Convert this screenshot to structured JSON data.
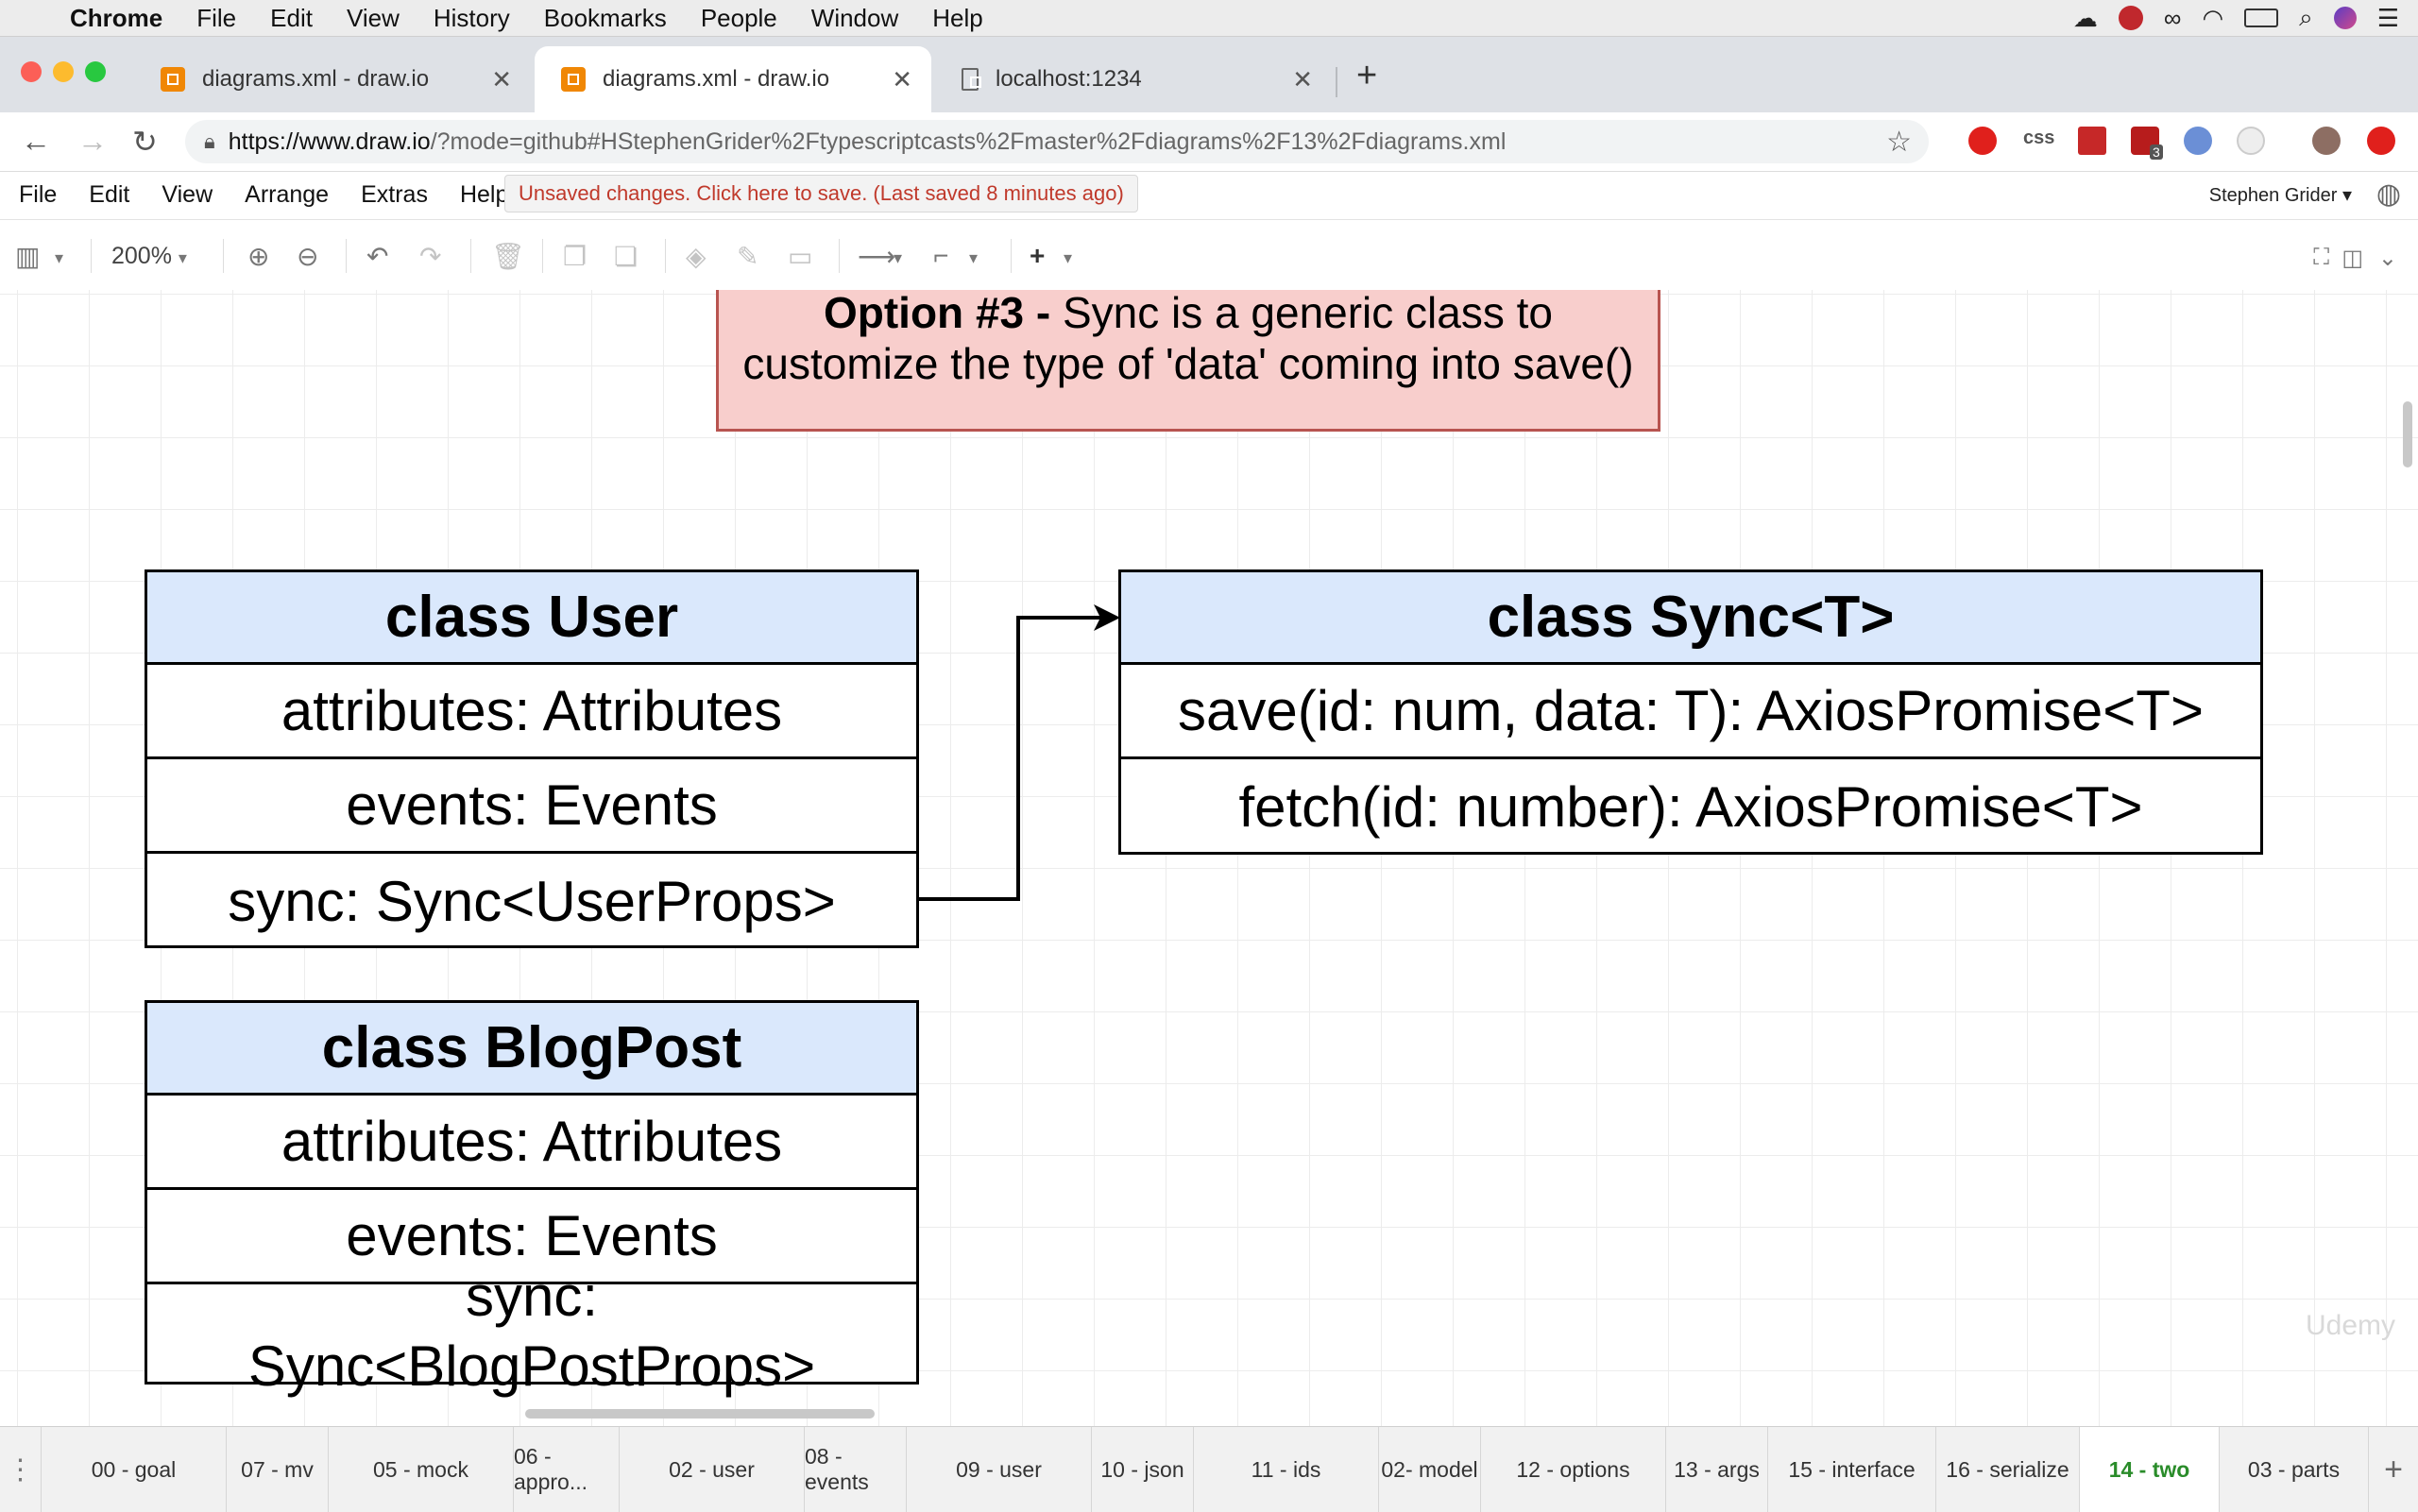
{
  "mac_menu": {
    "app_name": "Chrome",
    "items": [
      "File",
      "Edit",
      "View",
      "History",
      "Bookmarks",
      "People",
      "Window",
      "Help"
    ]
  },
  "browser": {
    "tabs": [
      {
        "title": "diagrams.xml - draw.io",
        "active": false
      },
      {
        "title": "diagrams.xml - draw.io",
        "active": true
      },
      {
        "title": "localhost:1234",
        "active": false
      }
    ],
    "new_tab": "+",
    "url": "https://www.draw.io/?mode=github#HStephenGrider%2Ftypescriptcasts%2Fmaster%2Fdiagrams%2F13%2Fdiagrams.xml",
    "url_host": "https://www.draw.io",
    "url_rest": "/?mode=github#HStephenGrider%2Ftypescriptcasts%2Fmaster%2Fdiagrams%2F13%2Fdiagrams.xml",
    "ext_badge": "3",
    "css_ext": "css"
  },
  "drawio": {
    "menu": [
      "File",
      "Edit",
      "View",
      "Arrange",
      "Extras",
      "Help"
    ],
    "unsaved_banner": "Unsaved changes. Click here to save. (Last saved 8 minutes ago)",
    "user": "Stephen Grider",
    "zoom": "200%"
  },
  "diagram": {
    "note_bold": "Option #3 -",
    "note_line1": " Sync is a generic class to",
    "note_line2": "customize the type of 'data' coming into save()",
    "user_class": {
      "title": "class User",
      "rows": [
        "attributes: Attributes",
        "events: Events",
        "sync: Sync<UserProps>"
      ]
    },
    "sync_class": {
      "title": "class Sync<T>",
      "rows": [
        "save(id: num, data: T): AxiosPromise<T>",
        "fetch(id: number): AxiosPromise<T>"
      ]
    },
    "blog_class": {
      "title": "class BlogPost",
      "rows": [
        "attributes: Attributes",
        "events: Events"
      ],
      "sync_line1": "sync:",
      "sync_line2": "Sync<BlogPostProps>"
    }
  },
  "watermark": "Udemy",
  "page_tabs": [
    "00 - goal",
    "07 - mv",
    "05 - mock",
    "06 - appro...",
    "02 - user",
    "08 - events",
    "09 - user",
    "10 - json",
    "11 - ids",
    "02- model",
    "12 - options",
    "13 - args",
    "15 - interface",
    "16 - serialize",
    "14 - two",
    "03 - parts"
  ],
  "selected_page_tab": "14 - two",
  "colors": {
    "note_fill": "#f8cecc",
    "note_stroke": "#b85450",
    "class_header": "#dae8fc",
    "selected_tab_text": "#2a8c2a",
    "unsaved_text": "#c0392b"
  }
}
